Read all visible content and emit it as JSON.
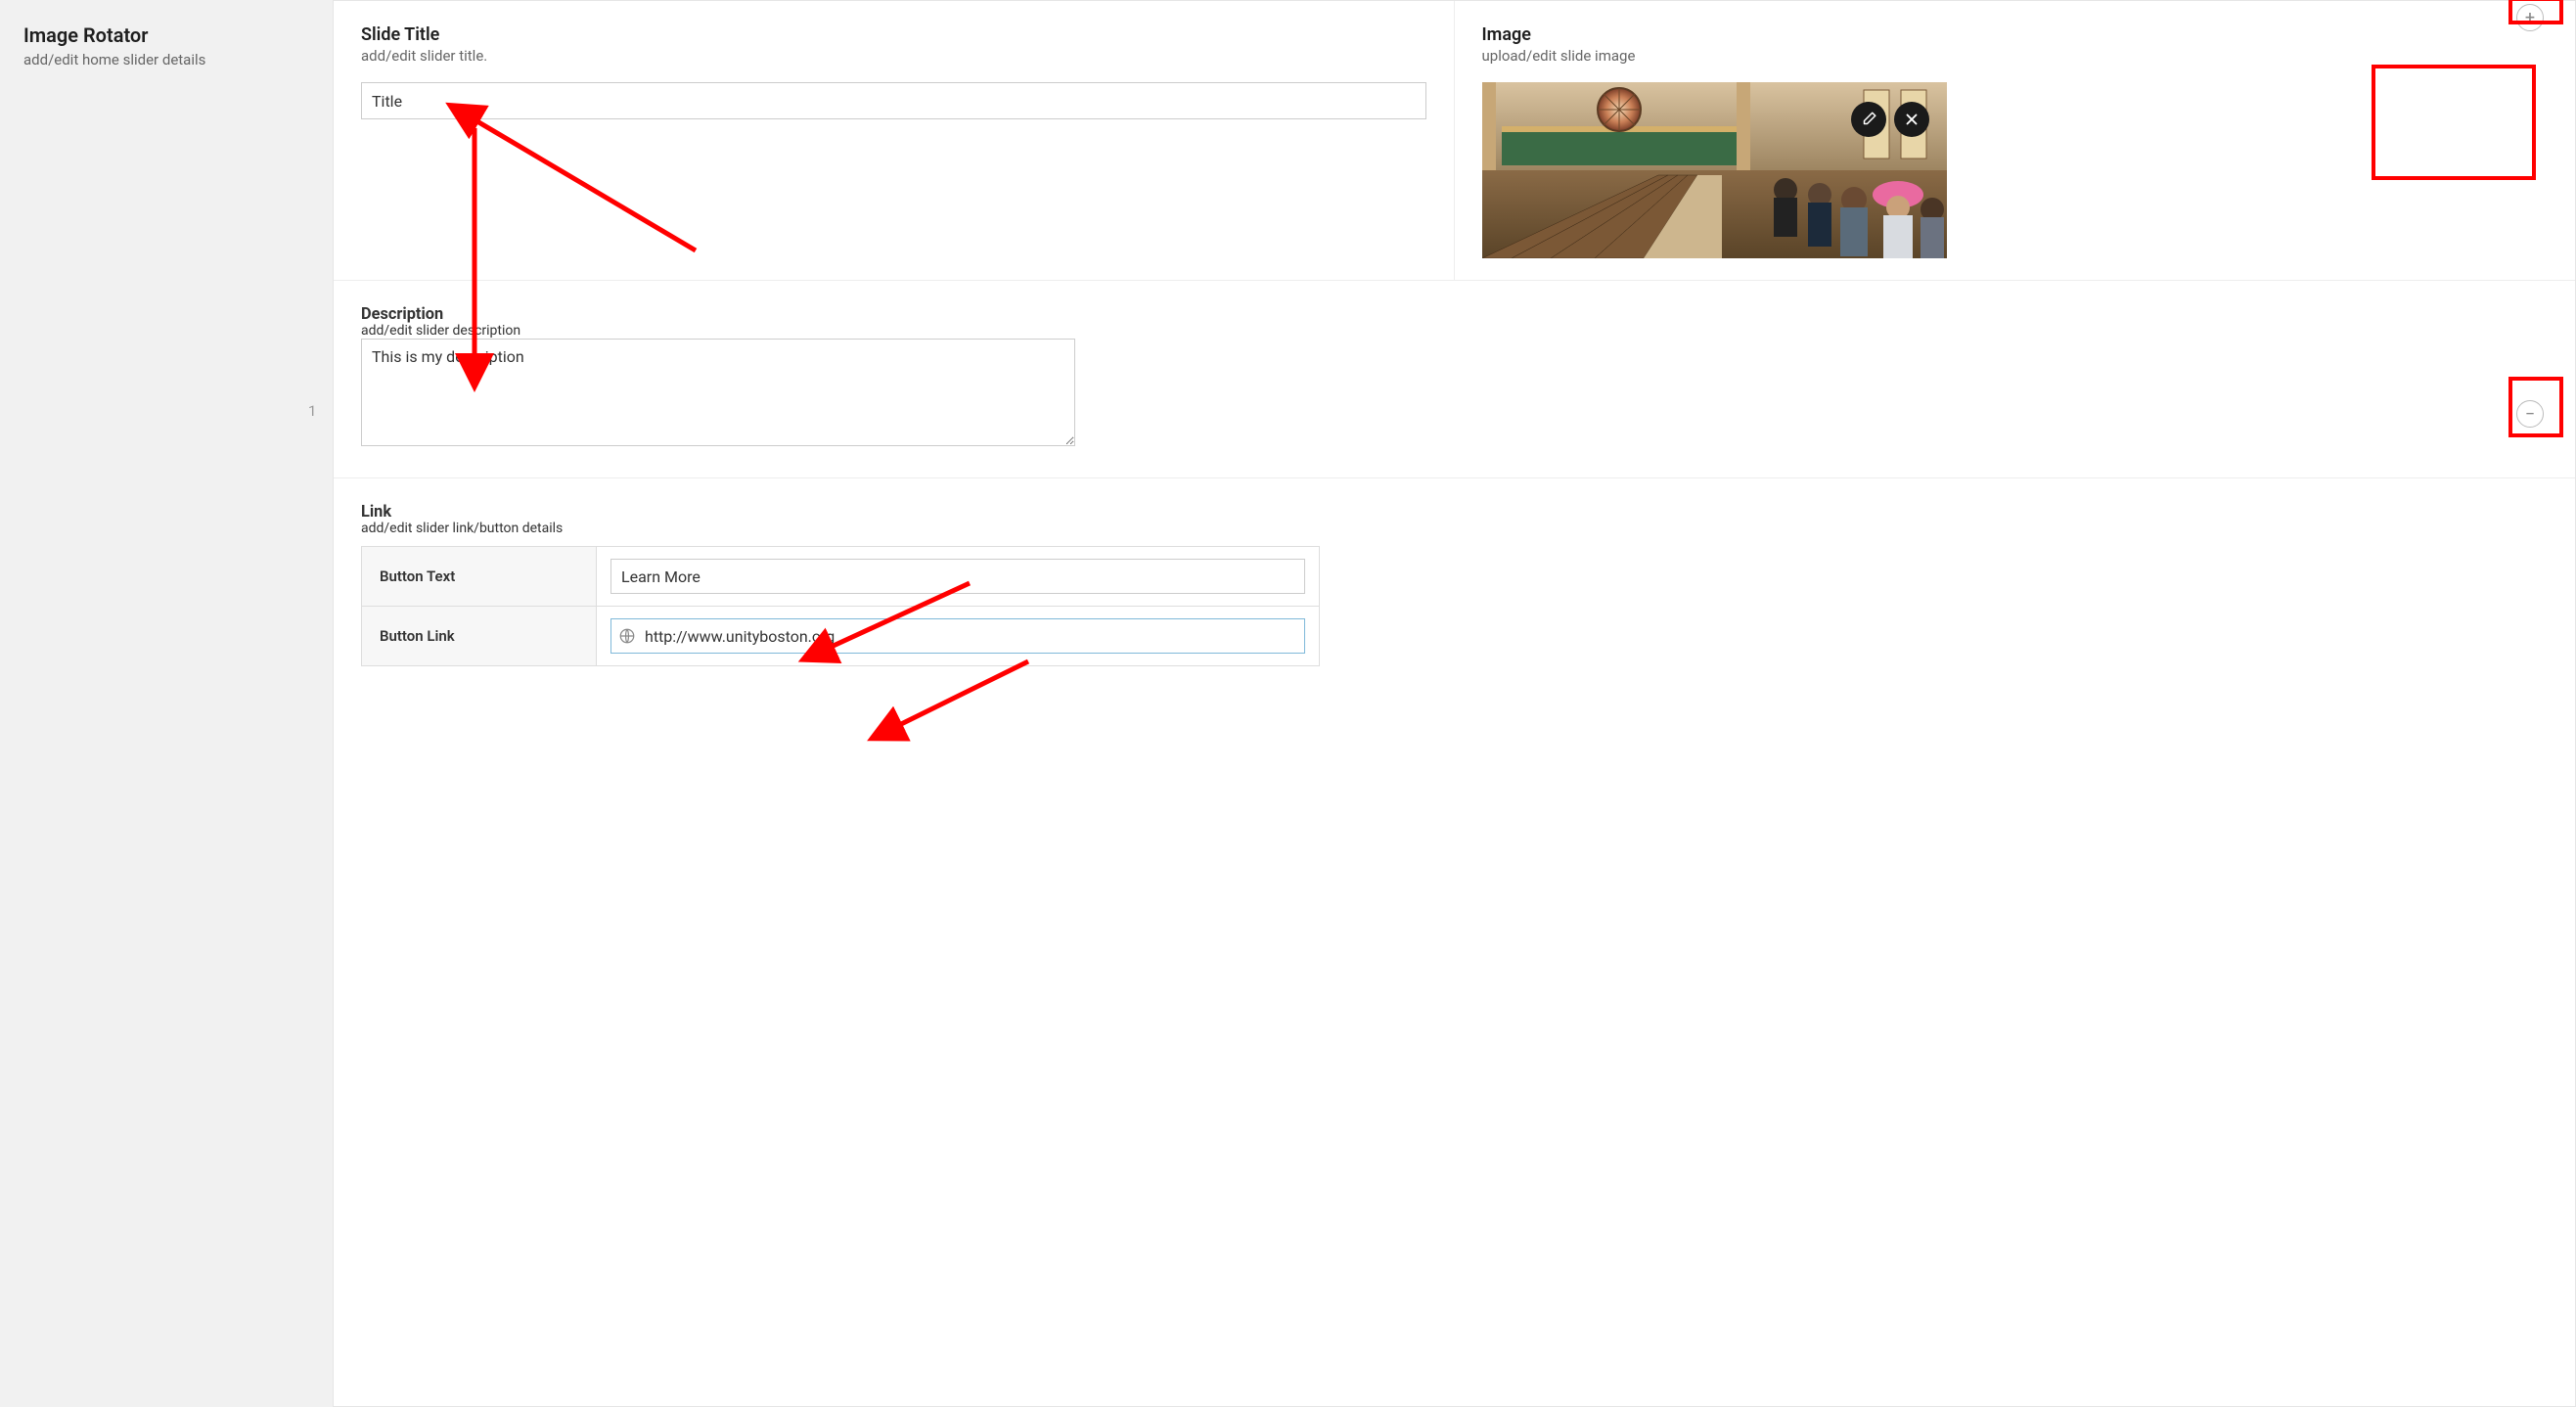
{
  "sidebar": {
    "title": "Image Rotator",
    "subtitle": "add/edit home slider details"
  },
  "slide": {
    "number": "1",
    "title_section": {
      "heading": "Slide Title",
      "subtitle": "add/edit slider title.",
      "value": "Title"
    },
    "image_section": {
      "heading": "Image",
      "subtitle": "upload/edit slide image",
      "edit_icon": "pencil-icon",
      "remove_icon": "close-icon"
    },
    "description_section": {
      "heading": "Description",
      "subtitle": "add/edit slider description",
      "value": "This is my description"
    },
    "link_section": {
      "heading": "Link",
      "subtitle": "add/edit slider link/button details",
      "button_text_label": "Button Text",
      "button_text_value": "Learn More",
      "button_link_label": "Button Link",
      "button_link_value": "http://www.unityboston.org"
    }
  },
  "controls": {
    "add": "+",
    "remove": "−"
  }
}
